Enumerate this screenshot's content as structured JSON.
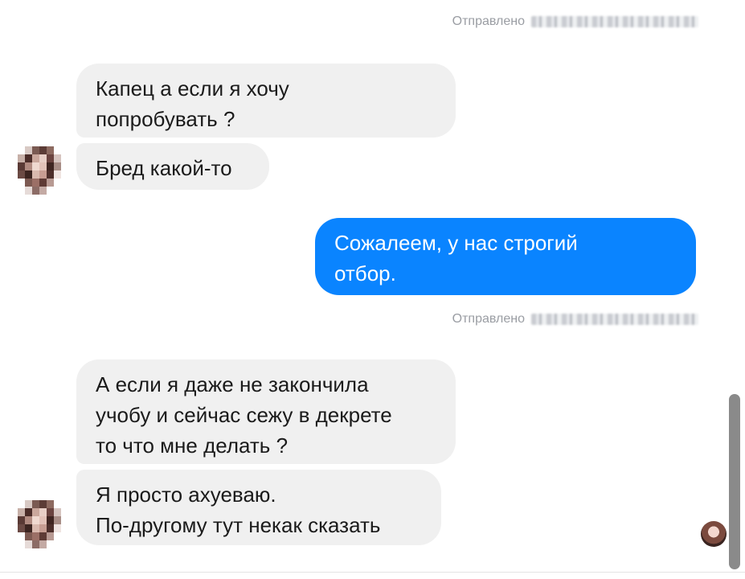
{
  "thread": {
    "meta_1": {
      "prefix": "Отправлено"
    },
    "meta_2": {
      "prefix": "Отправлено"
    },
    "messages": [
      {
        "text": "Капец а если я хочу\nпопробувать ?"
      },
      {
        "text": "Бред какой-то"
      },
      {
        "text": "Сожалеем, у нас строгий\nотбор."
      },
      {
        "text": "А если я даже не закончила\nучобу и сейчас сежу в декрете\nто что мне делать ?"
      },
      {
        "text": "Я просто ахуеваю.\nПо-другому тут некак сказать"
      }
    ]
  },
  "colors": {
    "incoming_bubble": "#f0f0f0",
    "outgoing_bubble": "#0a84ff",
    "meta_text": "#9a9da3",
    "scrollbar": "#8a8a8a"
  },
  "icons": {
    "contact_avatar": "avatar-icon",
    "seen_avatar": "seen-avatar-icon"
  }
}
